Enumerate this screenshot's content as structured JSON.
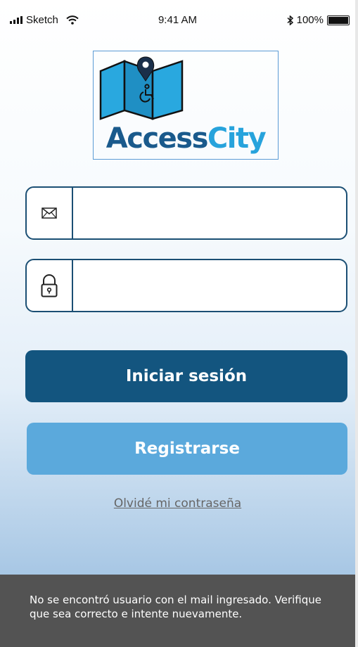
{
  "status_bar": {
    "carrier": "Sketch",
    "time": "9:41 AM",
    "battery": "100%",
    "battery_level": 1.0,
    "icons": [
      "signal-icon",
      "wifi-icon",
      "bluetooth-icon",
      "battery-icon"
    ]
  },
  "logo": {
    "text_part1": "Access",
    "text_part2": "City",
    "colors": {
      "dark": "#1a5a8c",
      "light": "#27a3dc",
      "map": "#29a8df"
    }
  },
  "login_form": {
    "email": {
      "icon": "envelope-icon",
      "value": "",
      "placeholder": ""
    },
    "password": {
      "icon": "padlock-icon",
      "value": "",
      "placeholder": ""
    }
  },
  "buttons": {
    "login_label": "Iniciar sesión",
    "register_label": "Registrarse",
    "login_color": "#13557f",
    "register_color": "#5ba9dc"
  },
  "links": {
    "forgot_password": "Olvidé mi contraseña"
  },
  "toast": {
    "message": "No se encontró usuario con el mail ingresado. Verifique que sea correcto e intente nuevamente."
  }
}
